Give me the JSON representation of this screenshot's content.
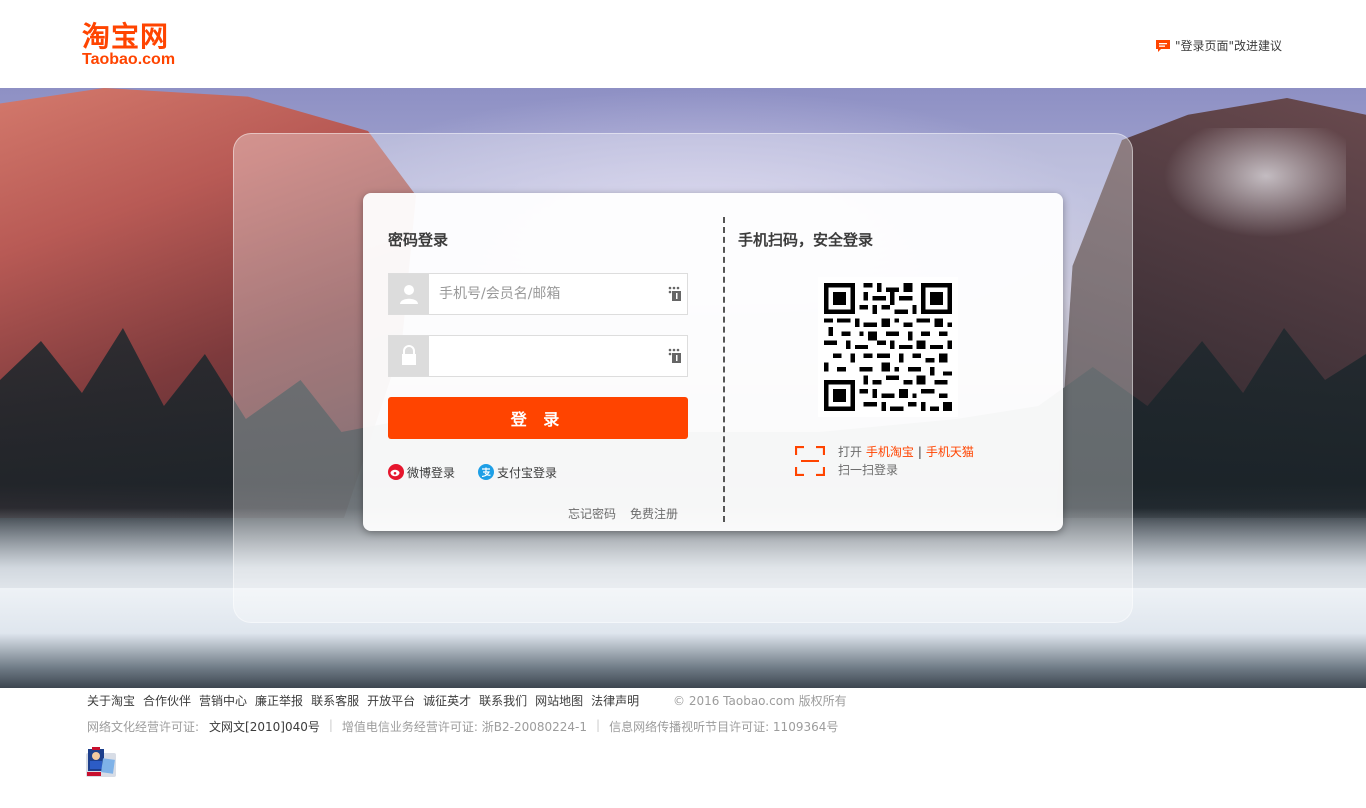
{
  "header": {
    "logo_cn": "淘宝网",
    "logo_en": "Taobao.com",
    "feedback_label": "\"登录页面\"改进建议"
  },
  "login": {
    "password_title": "密码登录",
    "username_placeholder": "手机号/会员名/邮箱",
    "password_placeholder": "",
    "login_button": "登 录",
    "weibo_login": "微博登录",
    "alipay_login": "支付宝登录",
    "forgot_password": "忘记密码",
    "register": "免费注册"
  },
  "qr": {
    "title": "手机扫码，安全登录",
    "open_label": "打开",
    "app_taobao": "手机淘宝",
    "separator": "|",
    "app_tmall": "手机天猫",
    "scan_label": "扫一扫登录"
  },
  "footer": {
    "links": [
      "关于淘宝",
      "合作伙伴",
      "营销中心",
      "廉正举报",
      "联系客服",
      "开放平台",
      "诚征英才",
      "联系我们",
      "网站地图",
      "法律声明"
    ],
    "copyright": "© 2016 Taobao.com 版权所有",
    "license1_label": "网络文化经营许可证:",
    "license1_value": "文网文[2010]040号",
    "license2": "增值电信业务经营许可证: 浙B2-20080224-1",
    "license3": "信息网络传播视听节目许可证: 1109364号"
  },
  "colors": {
    "brand": "#ff4400",
    "text": "#3c3c3c",
    "muted": "#9c9c9c"
  },
  "icons": [
    "comment-icon",
    "user-icon",
    "lock-icon",
    "keyboard-icon",
    "weibo-icon",
    "alipay-icon",
    "qr-code",
    "scan-icon",
    "police-badge-icon"
  ]
}
